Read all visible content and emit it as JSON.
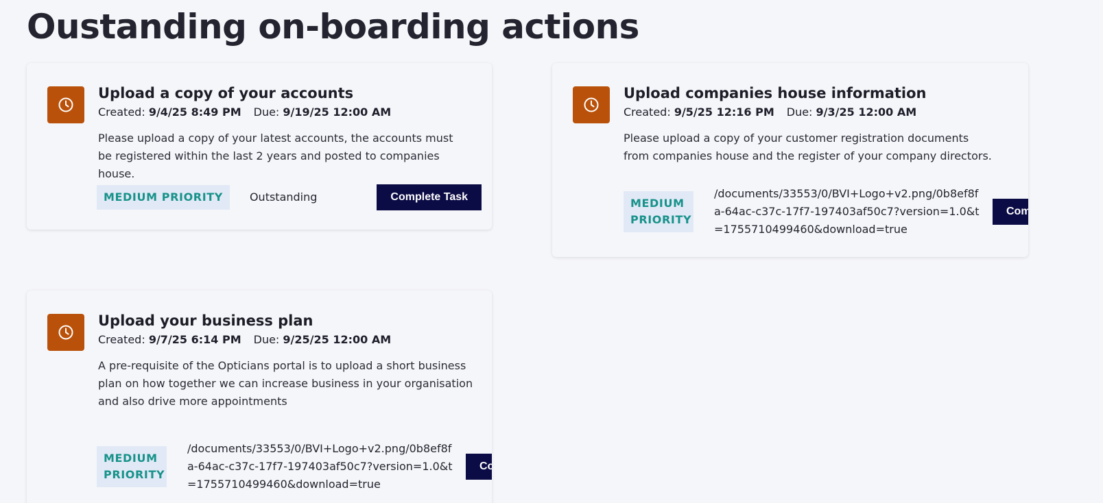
{
  "page": {
    "title": "Oustanding on-boarding actions"
  },
  "colors": {
    "icon_bg": "#b9510a",
    "badge_bg": "#e2e9f6",
    "badge_text": "#17928a",
    "button_bg": "#0b0b45"
  },
  "labels": {
    "created": "Created:",
    "due": "Due:"
  },
  "tasks": [
    {
      "icon": "clock-icon",
      "title": "Upload a copy of your accounts",
      "created": "9/4/25 8:49 PM",
      "due": "9/19/25 12:00 AM",
      "description": "Please upload a copy of your latest accounts, the accounts must be registered within the last 2 years and posted to companies house.",
      "priority": "MEDIUM PRIORITY",
      "status": "Outstanding",
      "button": "Complete Task"
    },
    {
      "icon": "clock-icon",
      "title": "Upload companies house information",
      "created": "9/5/25 12:16 PM",
      "due": "9/3/25 12:00 AM",
      "description": "Please upload a copy of your customer registration documents from companies house and the register of your company directors.",
      "priority": "MEDIUM PRIORITY",
      "status": "/documents/33553/0/BVI+Logo+v2.png/0b8ef8fa-64ac-c37c-17f7-197403af50c7?version=1.0&t=1755710499460&download=true",
      "button": "Complete Task"
    },
    {
      "icon": "clock-icon",
      "title": "Upload your business plan",
      "created": "9/7/25 6:14 PM",
      "due": "9/25/25 12:00 AM",
      "description": "A pre-requisite of the Opticians portal is to upload a short business plan on how together we can increase business in your organisation and also drive more appointments",
      "priority": "MEDIUM PRIORITY",
      "status": "/documents/33553/0/BVI+Logo+v2.png/0b8ef8fa-64ac-c37c-17f7-197403af50c7?version=1.0&t=1755710499460&download=true",
      "button": "Complete Task"
    }
  ]
}
